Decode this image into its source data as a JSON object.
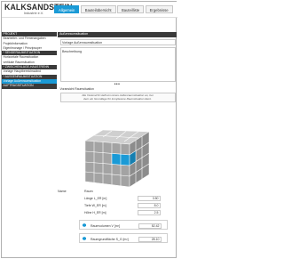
{
  "brand": {
    "name": "KALKSANDSTEIN",
    "sub": "Industrie e.V."
  },
  "tabs": [
    {
      "label": "Allgemein",
      "active": true
    },
    {
      "label": "Bauteilübersicht",
      "active": false
    },
    {
      "label": "Bauteilliste",
      "active": false
    },
    {
      "label": "Ergebnisse",
      "active": false
    }
  ],
  "sidebar": {
    "items": [
      {
        "label": "PROJEKT",
        "style": "header"
      },
      {
        "label": "Bearbeiter- und Firmenangaben",
        "style": "normal"
      },
      {
        "label": "Projektinformation",
        "style": "normal"
      },
      {
        "label": "Eigenlmonage / Prinzipsuper",
        "style": "normal"
      },
      {
        "label": "* SENDERAUMSITUATION",
        "style": "header"
      },
      {
        "label": "Horizontale Raumsituation",
        "style": "normal"
      },
      {
        "label": "vertikale Raumsituation",
        "style": "normal"
      },
      {
        "label": "* ZWISCHENLAGE-HAUSTRENN",
        "style": "header"
      },
      {
        "label": "Vorlage Hauptbereichswänd",
        "style": "normal"
      },
      {
        "label": "* AUSSENRAUMSITUATION",
        "style": "header"
      },
      {
        "label": "Vorlage Außenraumsituation",
        "style": "selected"
      },
      {
        "label": "AUFTRAGSITUATION",
        "style": "header"
      }
    ]
  },
  "main": {
    "header": "Außenraumsituation",
    "template_value": "Vorlage Außenraumsituation",
    "description_placeholder": "Beschreibung",
    "drag_handle": "•••",
    "preview_label": "Voransicht Raumsituation",
    "info_line1": "Die Voransicht stellt ein reines Außenraumsituation an, bei",
    "info_line2": "dem ein Grundlage für komplexere Raumsituation dient."
  },
  "colors": {
    "accent": "#1a9ad6",
    "cube_face": "#9e9e9e",
    "cube_highlight": "#1a9ad6"
  },
  "form": {
    "name_label": "Name",
    "name_value": "Raum",
    "length_label": "Länge L_ER [m]",
    "length_value": "3.50",
    "depth_label": "Tiefe W_ER [m]",
    "depth_value": "8.0",
    "height_label": "Höhe H_ER [m]",
    "height_value": "2.5",
    "volume_label": "Raumvolumen V [m³]",
    "volume_value": "52.42",
    "floor_label": "Raumgrundfläche S_G [m²]",
    "floor_value": "28.10"
  }
}
